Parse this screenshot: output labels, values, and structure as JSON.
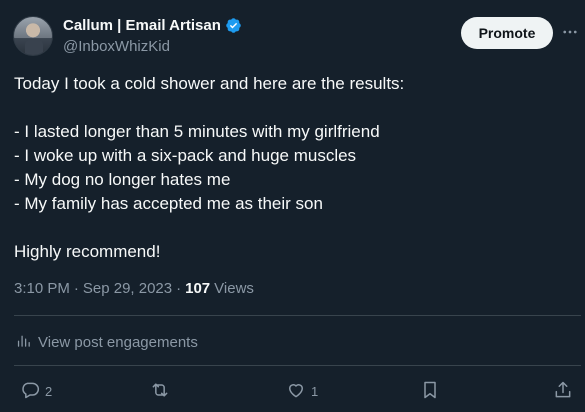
{
  "author": {
    "display_name": "Callum | Email Artisan",
    "handle": "@InboxWhizKid",
    "verified_icon": "verified-badge-icon"
  },
  "header": {
    "promote_label": "Promote",
    "more_icon": "more-horizontal-icon"
  },
  "post": {
    "lines": [
      "Today I took a cold shower and here are the results:",
      "",
      "- I lasted longer than 5 minutes with my girlfriend",
      "- I woke up with a six-pack and huge muscles",
      "- My dog no longer hates me",
      "- My family has accepted me as their son",
      "",
      "Highly recommend!"
    ]
  },
  "meta": {
    "time": "3:10 PM",
    "separator": "·",
    "date": "Sep 29, 2023",
    "views_count": "107",
    "views_label": "Views"
  },
  "engagements": {
    "icon": "bar-chart-icon",
    "label": "View post engagements"
  },
  "actions": {
    "reply_count": "2",
    "repost_count": "",
    "like_count": "1"
  },
  "colors": {
    "background": "#15202b",
    "text": "#f7f9f9",
    "secondary": "#8b98a5",
    "verified": "#1d9bf0",
    "divider": "#38444d"
  }
}
